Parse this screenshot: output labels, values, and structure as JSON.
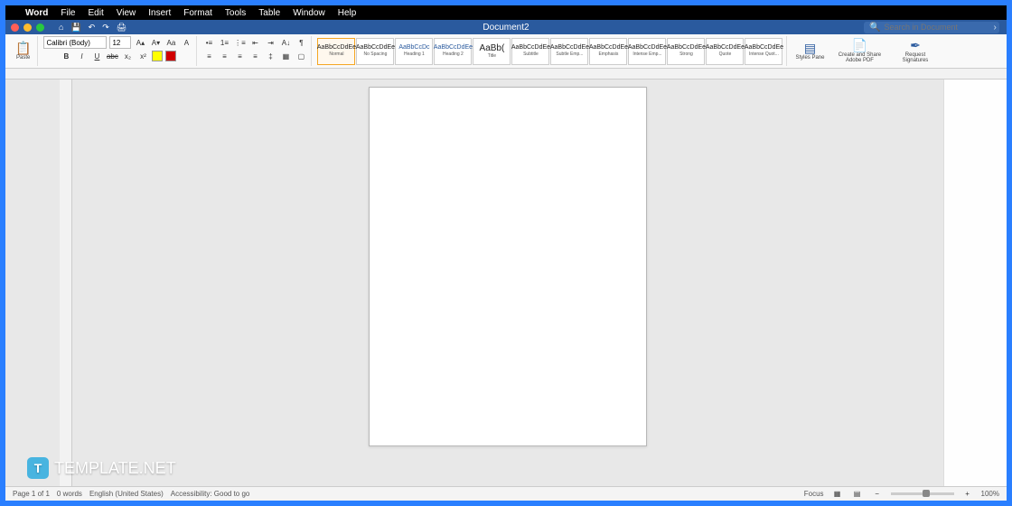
{
  "menubar": {
    "app": "Word",
    "items": [
      "File",
      "Edit",
      "View",
      "Insert",
      "Format",
      "Tools",
      "Table",
      "Window",
      "Help"
    ]
  },
  "titlebar": {
    "document": "Document2",
    "search_placeholder": "Search in Document"
  },
  "ribbon": {
    "paste_label": "Paste",
    "font": {
      "name": "Calibri (Body)",
      "size": "12"
    },
    "tools": {
      "bold": "B",
      "italic": "I",
      "underline": "U",
      "strike": "abc",
      "sub": "x₂",
      "sup": "x²",
      "clear": "A",
      "incfont": "A▴",
      "decfont": "A▾",
      "case": "Aa"
    },
    "styles": [
      {
        "preview": "AaBbCcDdEe",
        "label": "Normal",
        "sel": true
      },
      {
        "preview": "AaBbCcDdEe",
        "label": "No Spacing"
      },
      {
        "preview": "AaBbCcDc",
        "label": "Heading 1",
        "blue": true
      },
      {
        "preview": "AaBbCcDdEe",
        "label": "Heading 2",
        "blue": true
      },
      {
        "preview": "AaBb(",
        "label": "Title",
        "big": true
      },
      {
        "preview": "AaBbCcDdEe",
        "label": "Subtitle"
      },
      {
        "preview": "AaBbCcDdEe",
        "label": "Subtle Emp..."
      },
      {
        "preview": "AaBbCcDdEe",
        "label": "Emphasis"
      },
      {
        "preview": "AaBbCcDdEe",
        "label": "Intense Emp..."
      },
      {
        "preview": "AaBbCcDdEe",
        "label": "Strong"
      },
      {
        "preview": "AaBbCcDdEe",
        "label": "Quote"
      },
      {
        "preview": "AaBbCcDdEe",
        "label": "Intense Quot..."
      }
    ],
    "pane": {
      "styles": "Styles Pane",
      "pdf": "Create and Share Adobe PDF",
      "sig": "Request Signatures"
    }
  },
  "statusbar": {
    "page": "Page 1 of 1",
    "words": "0 words",
    "lang": "English (United States)",
    "access": "Accessibility: Good to go",
    "focus": "Focus",
    "zoom": "100%"
  },
  "watermark": "TEMPLATE.NET"
}
